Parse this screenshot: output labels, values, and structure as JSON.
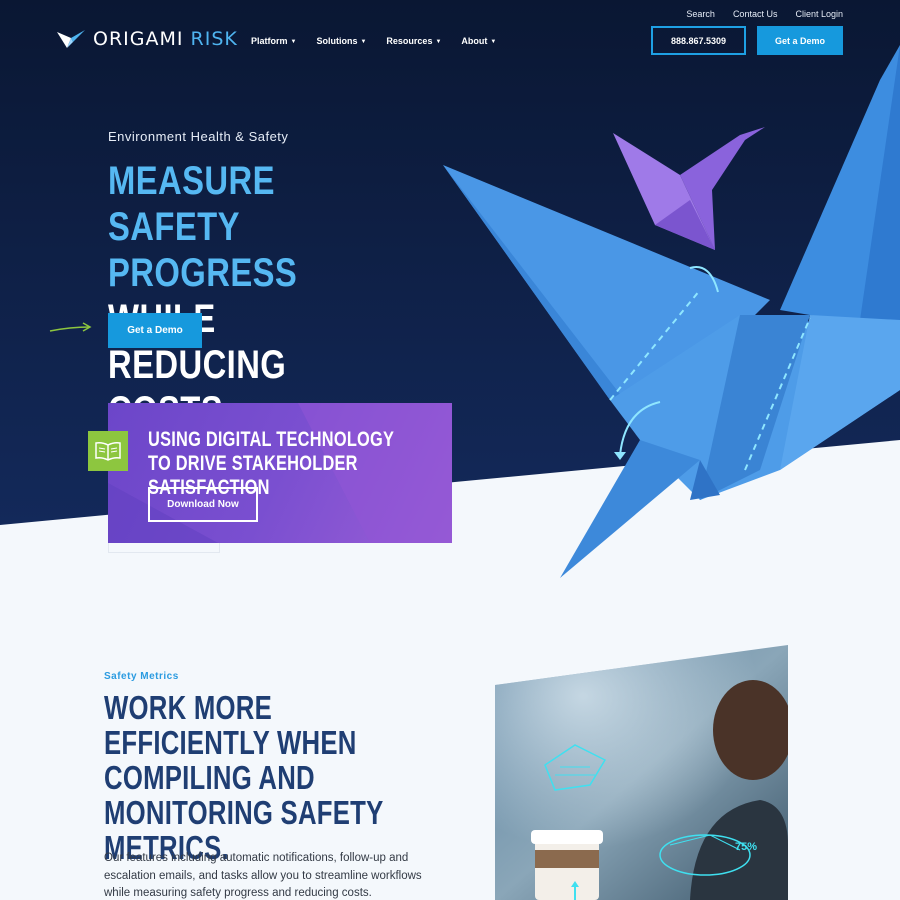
{
  "colors": {
    "navy": "#0b1a3a",
    "accent_blue": "#1699dd",
    "headline_blue": "#56b8f2",
    "purple": "#7a4fd0",
    "green": "#8dc63f",
    "section_title": "#1f3e73"
  },
  "utility_nav": {
    "search": "Search",
    "contact": "Contact Us",
    "login": "Client Login"
  },
  "logo": {
    "word1": "ORIGAMI",
    "word2": "RISK",
    "icon": "bird-logo-icon"
  },
  "main_nav": {
    "items": [
      {
        "label": "Platform"
      },
      {
        "label": "Solutions"
      },
      {
        "label": "Resources"
      },
      {
        "label": "About"
      }
    ]
  },
  "header_buttons": {
    "phone": "888.867.5309",
    "demo": "Get a Demo"
  },
  "hero": {
    "eyebrow": "Environment Health & Safety",
    "headline_part1": "MEASURE SAFETY PROGRESS",
    "headline_part2": " WHILE REDUCING COSTS",
    "cta": "Get a Demo"
  },
  "promo": {
    "title": "USING DIGITAL TECHNOLOGY TO DRIVE STAKEHOLDER SATISFACTION",
    "button": "Download Now",
    "icon": "open-book-icon"
  },
  "section": {
    "eyebrow": "Safety Metrics",
    "headline": "WORK MORE EFFICIENTLY WHEN COMPILING AND MONITORING SAFETY METRICS.",
    "body": "Our features including automatic notifications, follow-up and escalation emails, and tasks allow you to streamline workflows while measuring safety progress and reducing costs."
  },
  "photo": {
    "overlay_label": "75%"
  }
}
